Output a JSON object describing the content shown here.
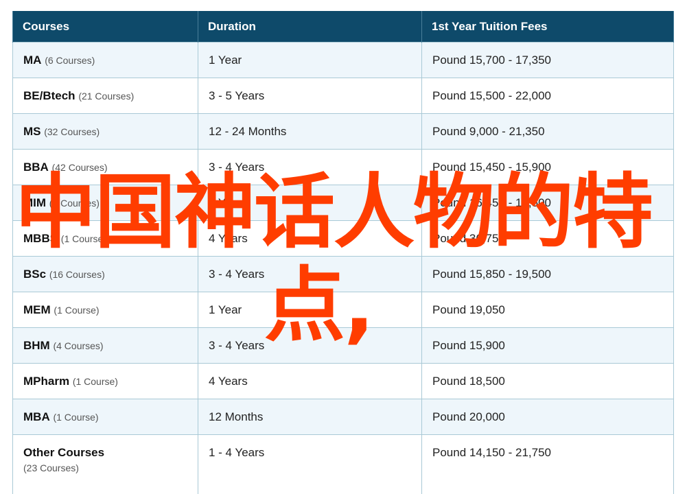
{
  "table": {
    "headers": {
      "course": "Courses",
      "duration": "Duration",
      "fees": "1st Year Tuition Fees"
    },
    "rows": [
      {
        "name": "MA",
        "count": "(6 Courses)",
        "duration": "1 Year",
        "fees": "Pound 15,700 - 17,350"
      },
      {
        "name": "BE/Btech",
        "count": "(21 Courses)",
        "duration": "3 - 5 Years",
        "fees": "Pound 15,500 - 22,000"
      },
      {
        "name": "MS",
        "count": "(32 Courses)",
        "duration": "12 - 24 Months",
        "fees": "Pound 9,000 - 21,350"
      },
      {
        "name": "BBA",
        "count": "(42 Courses)",
        "duration": "3 - 4 Years",
        "fees": "Pound 15,450 - 15,900"
      },
      {
        "name": "MIM",
        "count": "(2 Courses)",
        "duration": "1 Year",
        "fees": "Pound 16,450 - 17,500"
      },
      {
        "name": "MBBS",
        "count": "(1 Course)",
        "duration": "4 Years",
        "fees": "Pound 36,750"
      },
      {
        "name": "BSc",
        "count": "(16 Courses)",
        "duration": "3 - 4 Years",
        "fees": "Pound 15,850 - 19,500"
      },
      {
        "name": "MEM",
        "count": "(1 Course)",
        "duration": "1 Year",
        "fees": "Pound 19,050"
      },
      {
        "name": "BHM",
        "count": "(4 Courses)",
        "duration": "3 - 4 Years",
        "fees": "Pound 15,900"
      },
      {
        "name": "MPharm",
        "count": "(1 Course)",
        "duration": "4 Years",
        "fees": "Pound 18,500"
      },
      {
        "name": "MBA",
        "count": "(1 Course)",
        "duration": "12 Months",
        "fees": "Pound 20,000"
      },
      {
        "name": "Other Courses",
        "count": "(23 Courses)",
        "duration": "1 - 4 Years",
        "fees": "Pound 14,150 - 21,750"
      }
    ]
  },
  "overlay": {
    "line1": "中国神话人物的特",
    "line2": "点,",
    "color": "#ff3d00"
  },
  "colors": {
    "header_bg": "#0e4a6a",
    "row_alt_bg": "#eef6fb",
    "border": "#a9c9d6"
  }
}
